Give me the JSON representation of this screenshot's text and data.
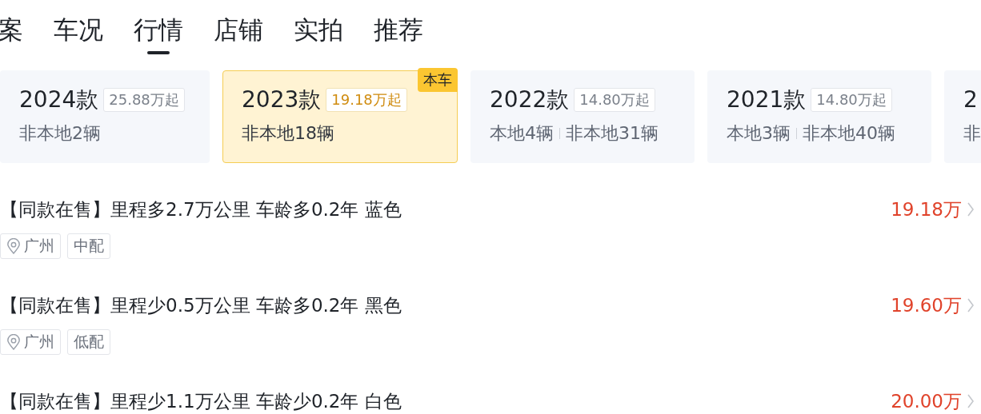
{
  "tabs": [
    {
      "label": "案",
      "selected": false
    },
    {
      "label": "车况",
      "selected": false
    },
    {
      "label": "行情",
      "selected": true
    },
    {
      "label": "店铺",
      "selected": false
    },
    {
      "label": "实拍",
      "selected": false
    },
    {
      "label": "推荐",
      "selected": false
    }
  ],
  "model_years": [
    {
      "year": "2024款",
      "price": "25.88万起",
      "counts": [
        "非本地2辆"
      ],
      "selected": false
    },
    {
      "year": "2023款",
      "price": "19.18万起",
      "counts": [
        "非本地18辆"
      ],
      "selected": true,
      "badge": "本车"
    },
    {
      "year": "2022款",
      "price": "14.80万起",
      "counts": [
        "本地4辆",
        "非本地31辆"
      ],
      "selected": false
    },
    {
      "year": "2021款",
      "price": "14.80万起",
      "counts": [
        "本地3辆",
        "非本地40辆"
      ],
      "selected": false
    },
    {
      "year": "2",
      "counts": [
        "非"
      ],
      "selected": false
    }
  ],
  "listings": [
    {
      "title": "【同款在售】里程多2.7万公里 车龄多0.2年 蓝色",
      "price": "19.18万",
      "tags": [
        {
          "kind": "location",
          "text": "广州"
        },
        {
          "kind": "plain",
          "text": "中配"
        }
      ]
    },
    {
      "title": "【同款在售】里程少0.5万公里 车龄多0.2年 黑色",
      "price": "19.60万",
      "tags": [
        {
          "kind": "location",
          "text": "广州"
        },
        {
          "kind": "plain",
          "text": "低配"
        }
      ]
    },
    {
      "title": "【同款在售】里程少1.1万公里 车龄少0.2年 白色",
      "price": "20.00万"
    }
  ]
}
